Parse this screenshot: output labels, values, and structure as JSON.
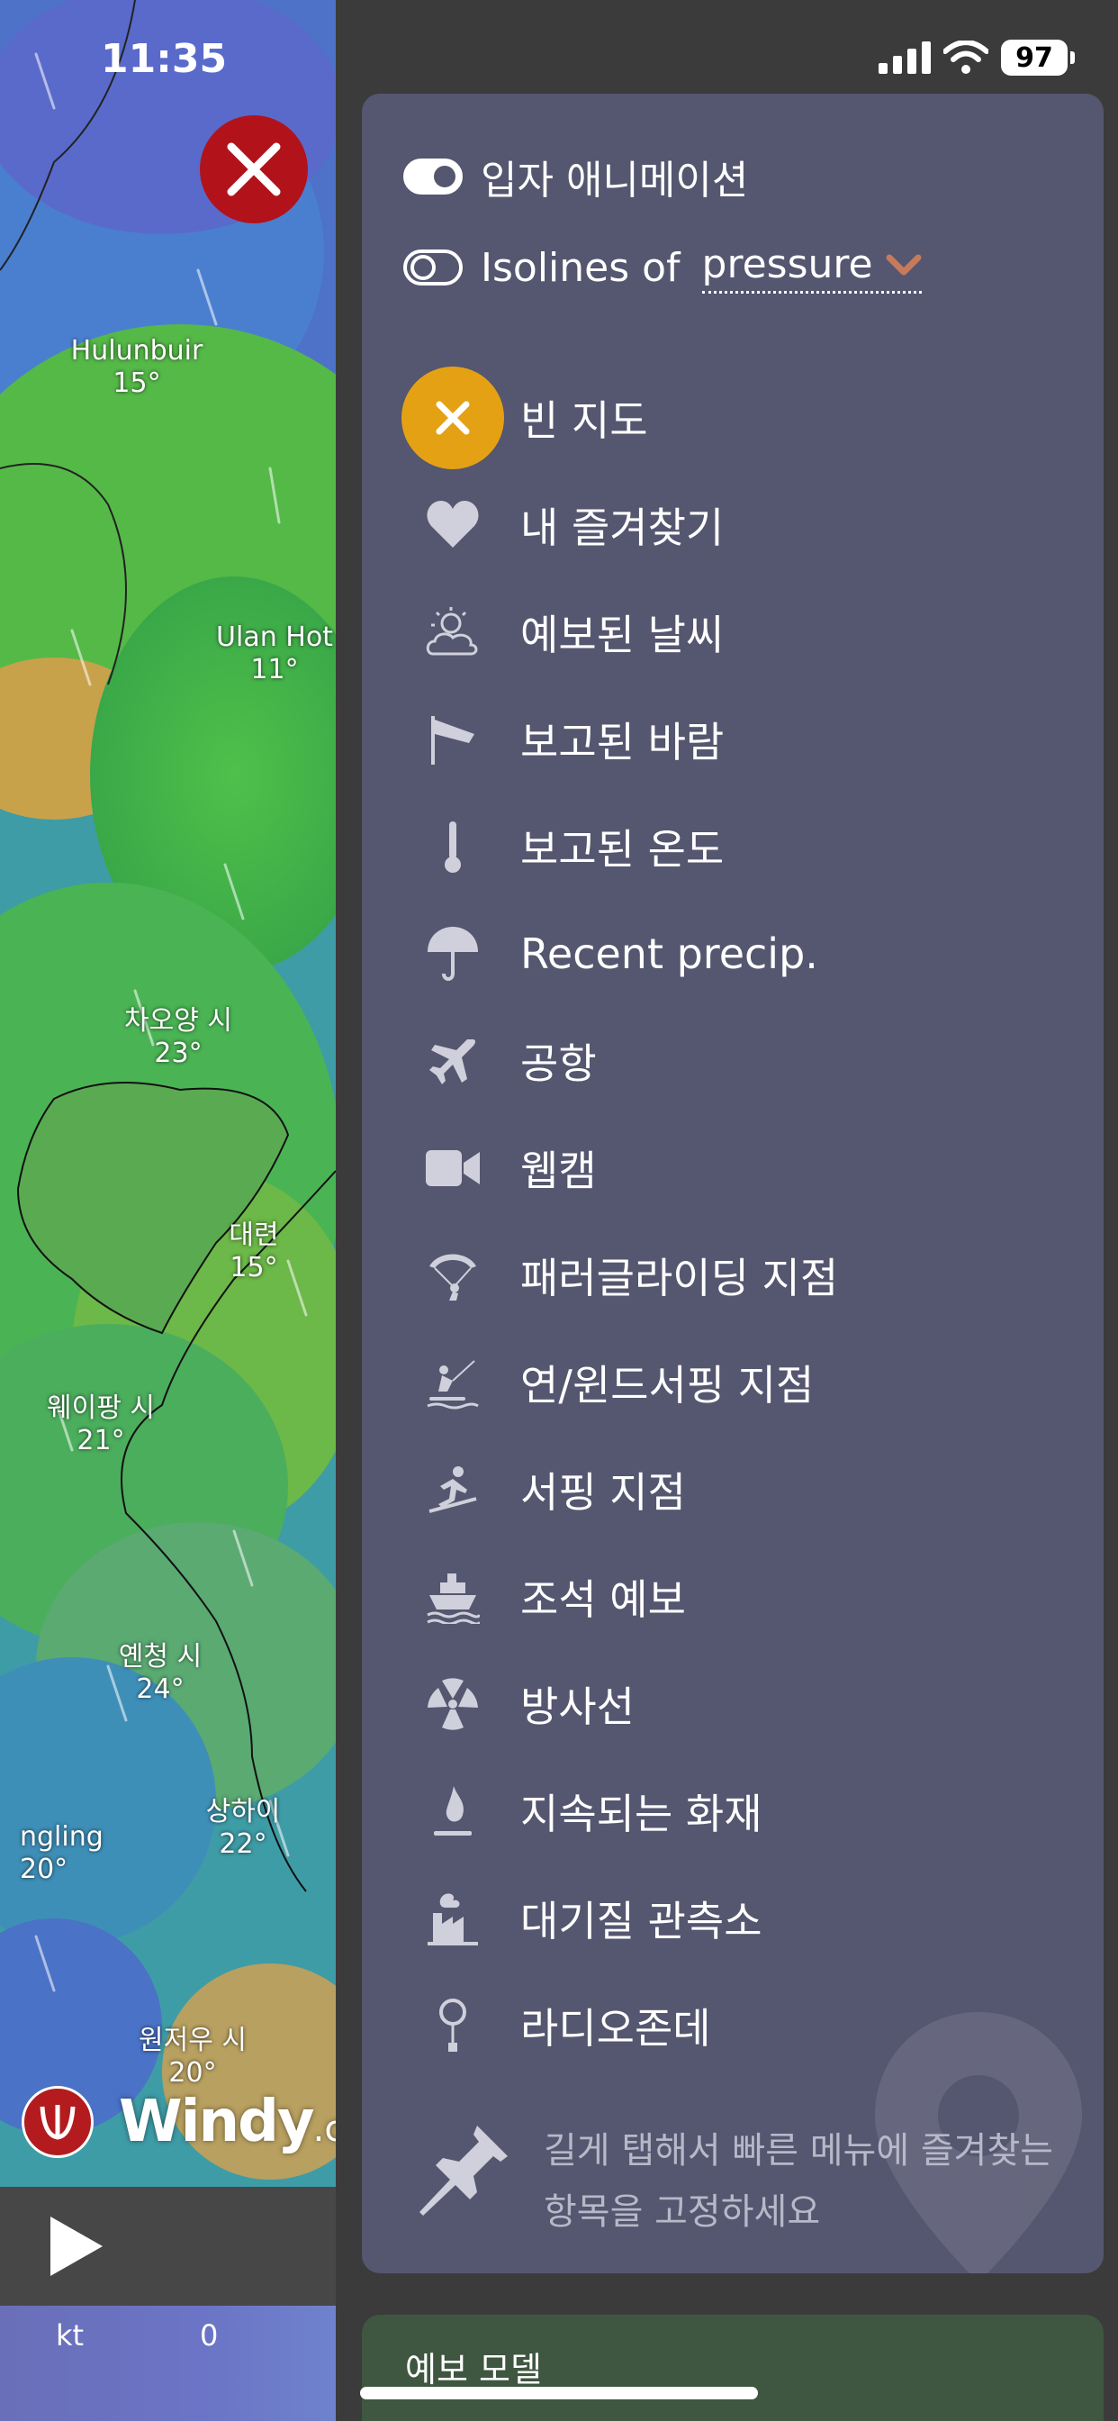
{
  "status_bar": {
    "time": "11:35",
    "battery": "97"
  },
  "map": {
    "cities": [
      {
        "name": "Hulunbuir",
        "temp": "15°"
      },
      {
        "name": "Ulan Hot",
        "temp": "11°"
      },
      {
        "name": "차오양 시",
        "temp": "23°"
      },
      {
        "name": "대련",
        "temp": "15°"
      },
      {
        "name": "웨이팡 시",
        "temp": "21°"
      },
      {
        "name": "옌청 시",
        "temp": "24°"
      },
      {
        "name": "상하이",
        "temp": "22°"
      },
      {
        "name": "ngling",
        "temp": "20°"
      },
      {
        "name": "원저우 시",
        "temp": "20°"
      }
    ],
    "logo_word": "Windy",
    "logo_domain": ".com"
  },
  "scale": {
    "unit": "kt",
    "zero": "0"
  },
  "menu": {
    "particle_toggle": {
      "label": "입자 애니메이션",
      "on": true
    },
    "isolines": {
      "label": "Isolines of",
      "value": "pressure",
      "on": false
    },
    "items": [
      {
        "label": "빈 지도",
        "icon": "close-icon",
        "active": true
      },
      {
        "label": "내 즐겨찾기",
        "icon": "heart-icon"
      },
      {
        "label": "예보된 날씨",
        "icon": "sun-cloud-icon"
      },
      {
        "label": "보고된 바람",
        "icon": "windsock-icon"
      },
      {
        "label": "보고된 온도",
        "icon": "thermometer-icon"
      },
      {
        "label": "Recent precip.",
        "icon": "umbrella-icon"
      },
      {
        "label": "공항",
        "icon": "airplane-icon"
      },
      {
        "label": "웹캠",
        "icon": "video-camera-icon"
      },
      {
        "label": "패러글라이딩 지점",
        "icon": "paraglider-icon"
      },
      {
        "label": "연/윈드서핑 지점",
        "icon": "kitesurf-icon"
      },
      {
        "label": "서핑 지점",
        "icon": "surfer-icon"
      },
      {
        "label": "조석 예보",
        "icon": "ship-icon"
      },
      {
        "label": "방사선",
        "icon": "radiation-icon"
      },
      {
        "label": "지속되는 화재",
        "icon": "fire-icon"
      },
      {
        "label": "대기질 관측소",
        "icon": "factory-icon"
      },
      {
        "label": "라디오존데",
        "icon": "balloon-icon"
      }
    ],
    "hint": "길게 탭해서 빠른 메뉴에 즐겨찾는 항목을 고정하세요"
  },
  "forecast_model_label": "예보 모델"
}
